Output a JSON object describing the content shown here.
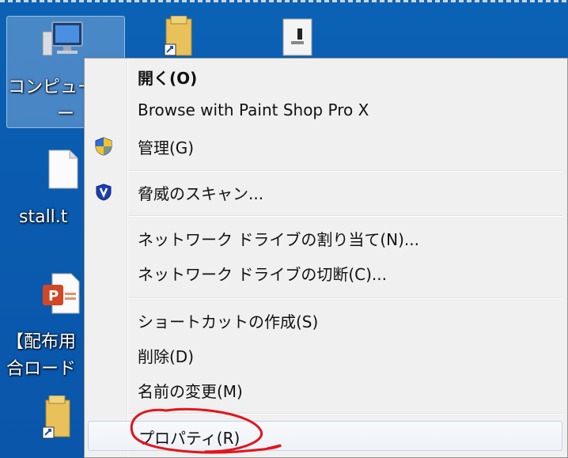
{
  "desktop": {
    "icons": [
      {
        "label_line1": "コンピュー",
        "label_line2": "ー",
        "icon": "computer-icon"
      },
      {
        "label": "stall.t",
        "icon": "text-file-icon"
      },
      {
        "label_line1": "【配布用",
        "label_line2": "合ロード",
        "icon": "powerpoint-icon"
      }
    ]
  },
  "context_menu": {
    "items": [
      {
        "label": "開く(O)",
        "bold": true
      },
      {
        "label": "Browse with Paint Shop Pro X"
      },
      {
        "label": "管理(G)",
        "icon": "uac-shield-icon"
      },
      {
        "label": "脅威のスキャン...",
        "icon": "antivirus-shield-icon"
      },
      {
        "label": "ネットワーク ドライブの割り当て(N)..."
      },
      {
        "label": "ネットワーク ドライブの切断(C)..."
      },
      {
        "label": "ショートカットの作成(S)"
      },
      {
        "label": "削除(D)"
      },
      {
        "label": "名前の変更(M)"
      },
      {
        "label": "プロパティ(R)",
        "highlighted": true
      }
    ]
  },
  "colors": {
    "desktop_bg": "#0a5bb0",
    "menu_bg": "#f0f0f0",
    "annotation": "#e3141b"
  }
}
